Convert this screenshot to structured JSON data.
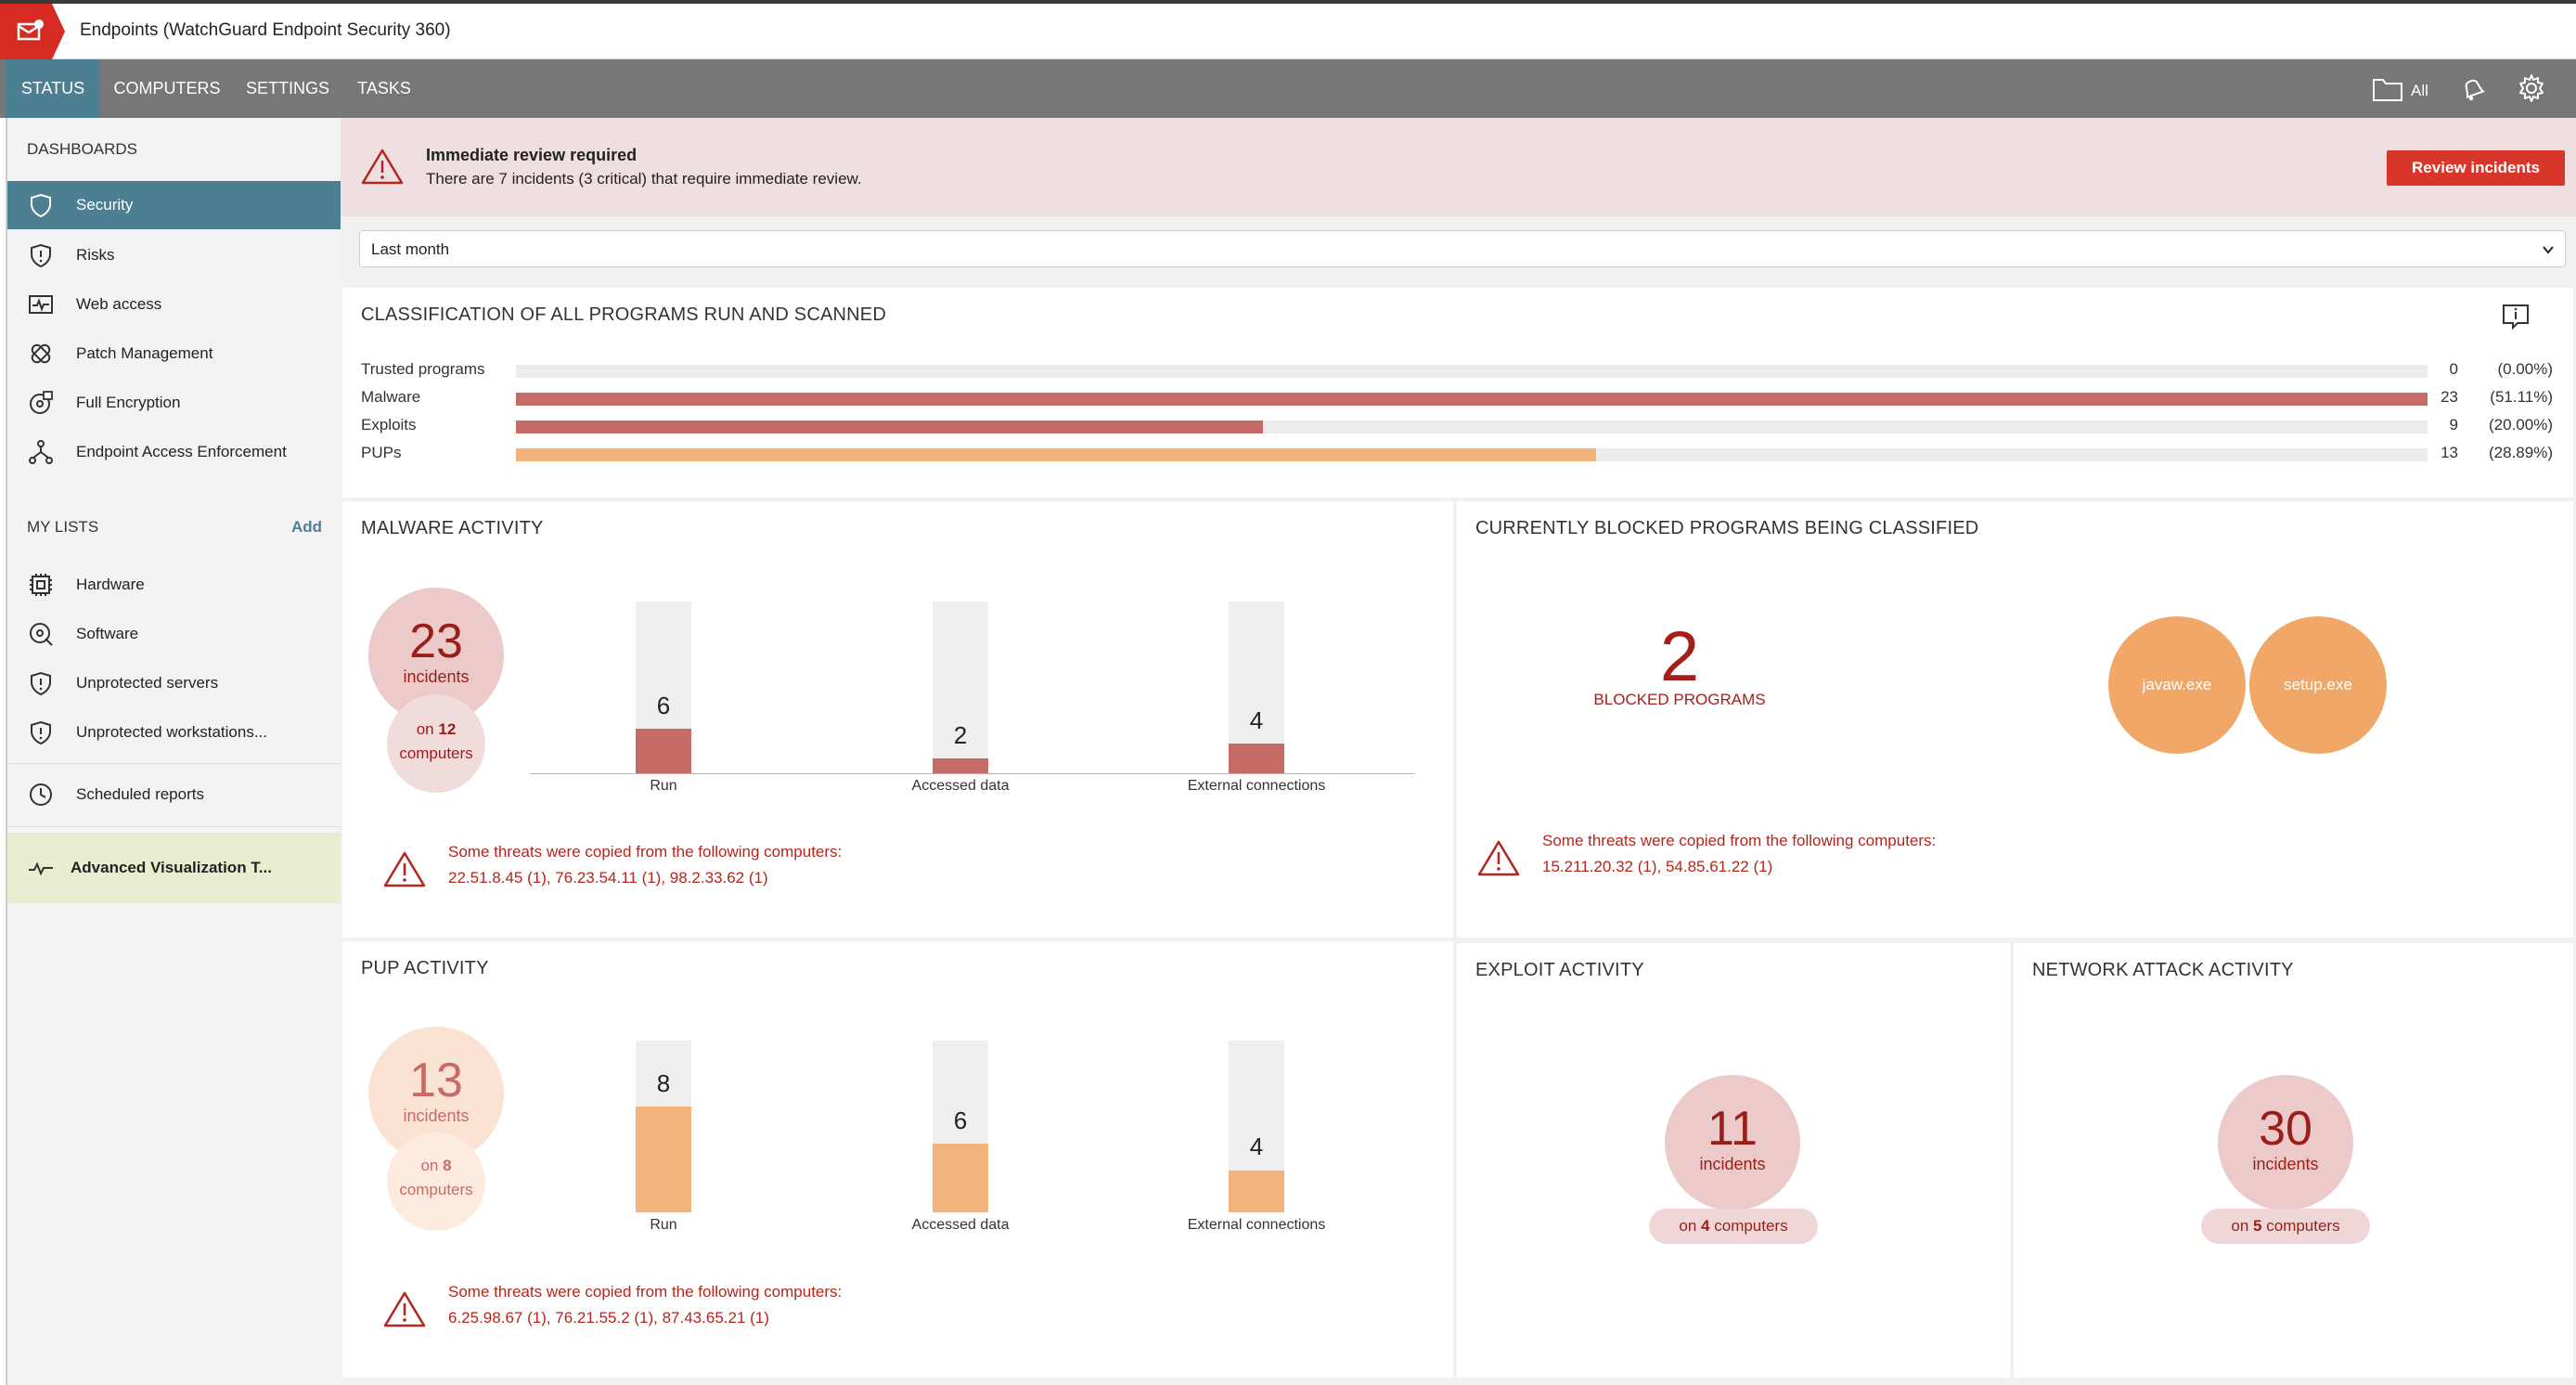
{
  "app": {
    "title": "Endpoints  (WatchGuard Endpoint Security 360)"
  },
  "nav": {
    "tabs": [
      "STATUS",
      "COMPUTERS",
      "SETTINGS",
      "TASKS"
    ],
    "active_tab": "STATUS",
    "folder_label": "All"
  },
  "sidebar": {
    "dashboards_heading": "DASHBOARDS",
    "dashboards": [
      {
        "label": "Security",
        "icon": "shield-icon",
        "active": true
      },
      {
        "label": "Risks",
        "icon": "shield-exclamation-icon"
      },
      {
        "label": "Web access",
        "icon": "pulse-monitor-icon"
      },
      {
        "label": "Patch Management",
        "icon": "bandage-icon"
      },
      {
        "label": "Full Encryption",
        "icon": "lock-disk-icon"
      },
      {
        "label": "Endpoint Access Enforcement",
        "icon": "network-nodes-icon"
      }
    ],
    "lists_heading": "MY LISTS",
    "add_label": "Add",
    "lists": [
      {
        "label": "Hardware",
        "icon": "chip-icon"
      },
      {
        "label": "Software",
        "icon": "disc-icon"
      },
      {
        "label": "Unprotected servers",
        "icon": "shield-exclamation-icon"
      },
      {
        "label": "Unprotected workstations...",
        "icon": "shield-exclamation-icon"
      }
    ],
    "scheduled_label": "Scheduled reports",
    "advanced_label": "Advanced Visualization T..."
  },
  "alert": {
    "title": "Immediate review required",
    "text": "There are 7 incidents (3 critical) that require immediate review.",
    "button": "Review incidents"
  },
  "period": {
    "selected": "Last month"
  },
  "classification": {
    "title": "CLASSIFICATION OF ALL PROGRAMS RUN AND SCANNED",
    "rows": [
      {
        "label": "Trusted programs",
        "count": "0",
        "pct": "(0.00%)",
        "fraction": 0.0,
        "color": "#e07b77"
      },
      {
        "label": "Malware",
        "count": "23",
        "pct": "(51.11%)",
        "fraction": 1.0,
        "color": "#c86a66"
      },
      {
        "label": "Exploits",
        "count": "9",
        "pct": "(20.00%)",
        "fraction": 0.391,
        "color": "#c86a66"
      },
      {
        "label": "PUPs",
        "count": "13",
        "pct": "(28.89%)",
        "fraction": 0.565,
        "color": "#f2b47a"
      }
    ]
  },
  "malware": {
    "title": "MALWARE ACTIVITY",
    "incidents": "23",
    "incidents_label": "incidents",
    "on_prefix": "on",
    "computers": "12",
    "computers_label": "computers",
    "bars": [
      {
        "value": "6",
        "fraction": 0.261,
        "label": "Run"
      },
      {
        "value": "2",
        "fraction": 0.087,
        "label": "Accessed data"
      },
      {
        "value": "4",
        "fraction": 0.174,
        "label": "External connections"
      }
    ],
    "warning": "Some threats were copied from the following computers:",
    "ips": "22.51.8.45 (1), 76.23.54.11 (1), 98.2.33.62 (1)"
  },
  "blocked": {
    "title": "CURRENTLY BLOCKED PROGRAMS BEING CLASSIFIED",
    "count": "2",
    "label": "BLOCKED PROGRAMS",
    "programs": [
      "javaw.exe",
      "setup.exe"
    ],
    "warning": "Some threats were copied from the following computers:",
    "ips": "15.211.20.32 (1), 54.85.61.22 (1)"
  },
  "pup": {
    "title": "PUP ACTIVITY",
    "incidents": "13",
    "incidents_label": "incidents",
    "on_prefix": "on",
    "computers": "8",
    "computers_label": "computers",
    "bars": [
      {
        "value": "8",
        "fraction": 0.615,
        "label": "Run"
      },
      {
        "value": "6",
        "fraction": 0.4,
        "label": "Accessed data"
      },
      {
        "value": "4",
        "fraction": 0.246,
        "label": "External connections"
      }
    ],
    "warning": "Some threats were copied from the following computers:",
    "ips": "6.25.98.67 (1), 76.21.55.2 (1), 87.43.65.21 (1)"
  },
  "exploit": {
    "title": "EXPLOIT ACTIVITY",
    "incidents": "11",
    "incidents_label": "incidents",
    "on_prefix": "on",
    "computers": "4",
    "computers_label": "computers"
  },
  "network": {
    "title": "NETWORK ATTACK ACTIVITY",
    "incidents": "30",
    "incidents_label": "incidents",
    "on_prefix": "on",
    "computers": "5",
    "computers_label": "computers"
  },
  "colors": {
    "accent": "#4d7f93",
    "danger": "#d9362b",
    "malware": "#c86a66",
    "pup": "#f2b47a",
    "bubble": "#f0a767"
  }
}
